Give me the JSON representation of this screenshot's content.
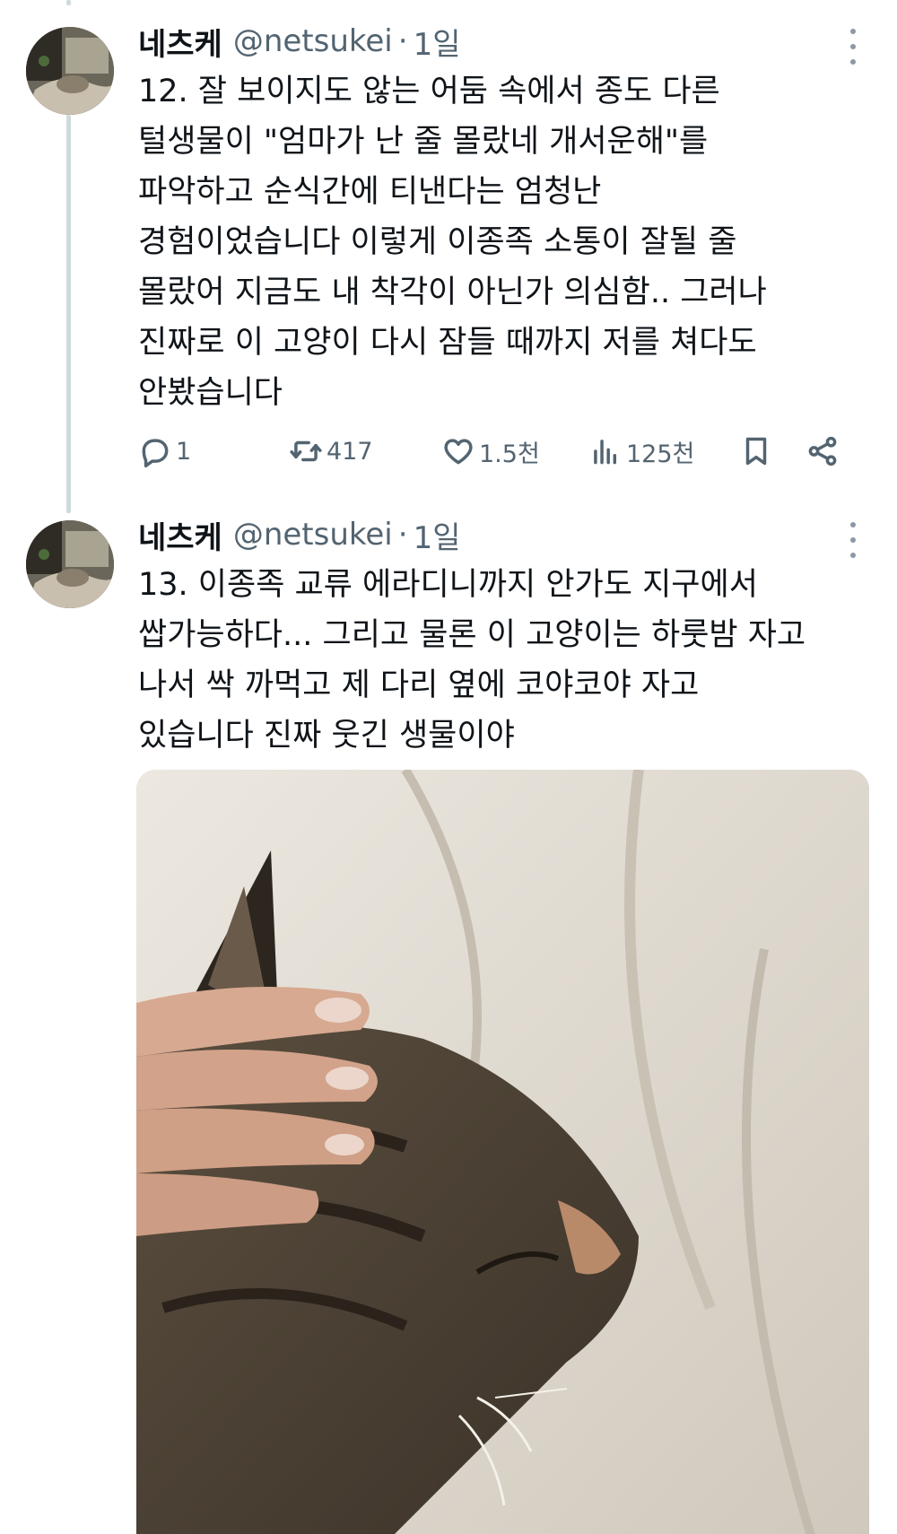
{
  "tweets": [
    {
      "author_name": "네츠케",
      "author_handle": "@netsukei",
      "separator": "·",
      "timestamp": "1일",
      "text_lines": [
        "12. 잘 보이지도 않는 어둠 속에서 종도 다른",
        "털생물이 \"엄마가 난 줄 몰랐네 개서운해\"를",
        "파악하고 순식간에 티낸다는 엄청난",
        "경험이었습니다 이렇게 이종족 소통이 잘될 줄",
        "몰랐어 지금도 내 착각이 아닌가 의심함.. 그러나",
        "진짜로 이 고양이 다시 잠들 때까지 저를 쳐다도",
        "안봤습니다"
      ],
      "stats": {
        "replies": "1",
        "retweets": "417",
        "likes": "1.5천",
        "views": "125천"
      }
    },
    {
      "author_name": "네츠케",
      "author_handle": "@netsukei",
      "separator": "·",
      "timestamp": "1일",
      "text_lines": [
        "13. 이종족 교류 에라디니까지 안가도 지구에서",
        "쌉가능하다... 그리고 물론 이 고양이는 하룻밤 자고",
        "나서 싹 까먹고 제 다리 옆에 코야코야 자고",
        "있습니다 진짜 웃긴 생물이야"
      ]
    }
  ],
  "icons": {
    "avatar": "avatar-photo",
    "more": "more-dots-icon",
    "reply": "reply-icon",
    "retweet": "retweet-icon",
    "like": "heart-icon",
    "views": "views-icon",
    "bookmark": "bookmark-icon",
    "share": "share-icon"
  },
  "colors": {
    "text": "#0f1419",
    "secondary": "#536471",
    "thread_line": "#cfd9de"
  }
}
